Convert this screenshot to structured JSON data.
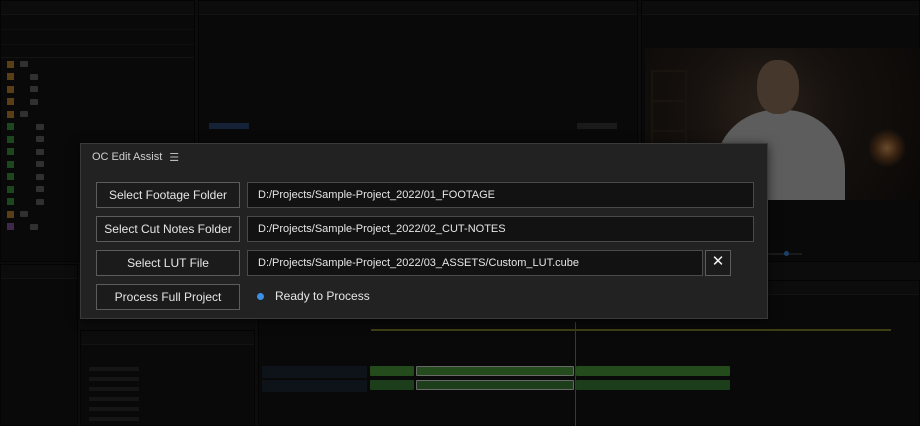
{
  "dialog": {
    "title": "OC Edit Assist",
    "menu_icon": "hamburger-menu-icon",
    "buttons": {
      "footage": "Select Footage Folder",
      "cut_notes": "Select Cut Notes Folder",
      "lut": "Select LUT File",
      "process": "Process Full Project"
    },
    "fields": {
      "footage": "D:/Projects/Sample-Project_2022/01_FOOTAGE",
      "cut_notes": "D:/Projects/Sample-Project_2022/02_CUT-NOTES",
      "lut": "D:/Projects/Sample-Project_2022/03_ASSETS/Custom_LUT.cube"
    },
    "clear_lut_label": "✕",
    "status": {
      "text": "Ready to Process",
      "color": "#3d8fe6"
    }
  },
  "colors": {
    "accent_blue": "#3d8fe6",
    "clip_green": "#4ea63e",
    "label_orange": "#c98a2e",
    "label_green": "#3f9d3f",
    "label_purple": "#8a5aa8"
  }
}
